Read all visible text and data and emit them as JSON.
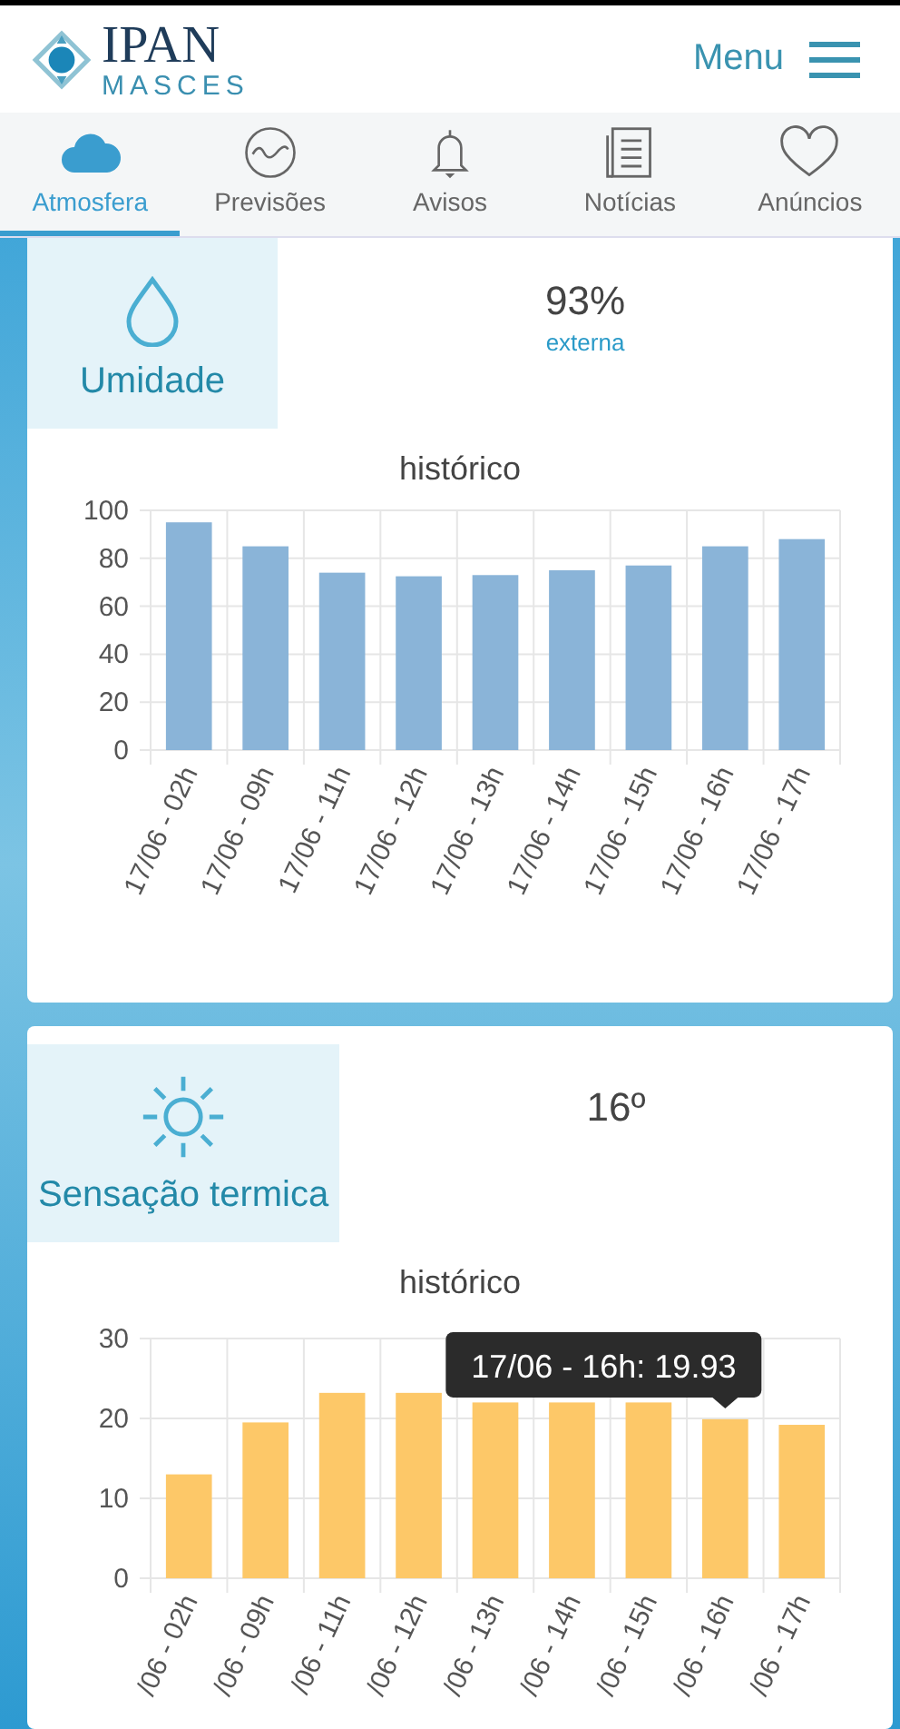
{
  "header": {
    "logo_title": "IPAN",
    "logo_subtitle": "MASCES",
    "menu_label": "Menu"
  },
  "tabs": [
    {
      "label": "Atmosfera",
      "selected": true
    },
    {
      "label": "Previsões",
      "selected": false
    },
    {
      "label": "Avisos",
      "selected": false
    },
    {
      "label": "Notícias",
      "selected": false
    },
    {
      "label": "Anúncios",
      "selected": false
    }
  ],
  "cards": [
    {
      "title": "Umidade",
      "reading": "93%",
      "reading_note": "externa",
      "section_title": "histórico",
      "chart_data": {
        "type": "bar",
        "categories": [
          "17/06 - 02h",
          "17/06 - 09h",
          "17/06 - 11h",
          "17/06 - 12h",
          "17/06 - 13h",
          "17/06 - 14h",
          "17/06 - 15h",
          "17/06 - 16h",
          "17/06 - 17h"
        ],
        "series": [
          {
            "color": "#8ab4d8",
            "values": [
              95,
              85,
              74,
              72.5,
              73,
              75,
              77,
              85,
              88
            ]
          }
        ],
        "ylim": [
          0,
          100
        ],
        "yticks": [
          0,
          20,
          40,
          60,
          80,
          100
        ],
        "grid": true
      }
    },
    {
      "title": "Sensação termica",
      "reading": "16º",
      "section_title": "histórico",
      "chart_data": {
        "type": "bar",
        "categories": [
          "/06 - 02h",
          "/06 - 09h",
          "/06 - 11h",
          "/06 - 12h",
          "/06 - 13h",
          "/06 - 14h",
          "/06 - 15h",
          "/06 - 16h",
          "/06 - 17h"
        ],
        "series": [
          {
            "color": "#fdc868",
            "values": [
              13,
              19.5,
              23.2,
              23.2,
              22,
              22,
              22,
              19.9,
              19.2
            ]
          }
        ],
        "ylim": [
          0,
          30
        ],
        "yticks": [
          0,
          10,
          20,
          30
        ],
        "grid": true,
        "annotations": [
          {
            "x": "/06 - 16h",
            "y": 19.9,
            "text": "17/06 - 16h: 19.93"
          }
        ]
      }
    }
  ]
}
